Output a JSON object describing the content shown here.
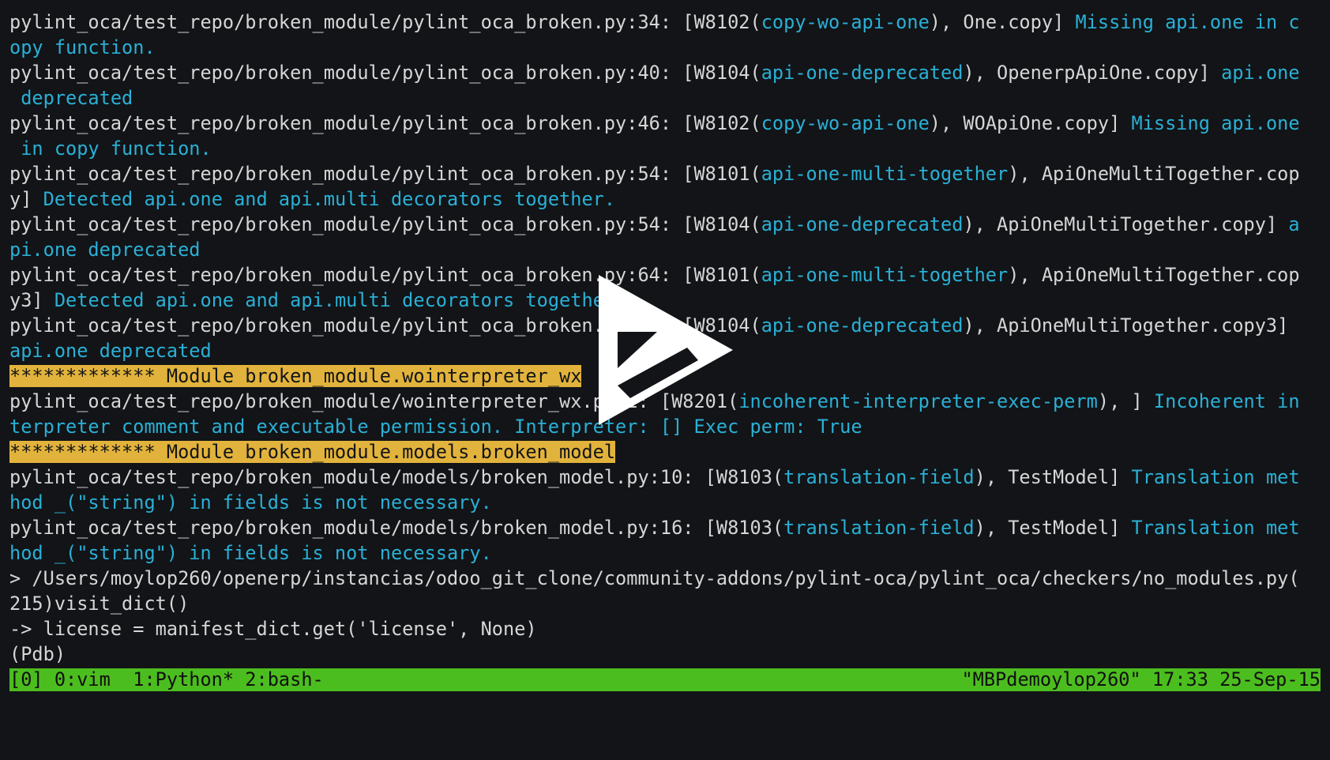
{
  "terminal": {
    "lines": [
      [
        {
          "t": "pylint_oca/test_repo/broken_module/pylint_oca_broken.py:34: [W8102(",
          "c": "white"
        },
        {
          "t": "copy-wo-api-one",
          "c": "cyan"
        },
        {
          "t": "), One.copy] ",
          "c": "white"
        },
        {
          "t": "Missing api.one in c",
          "c": "cyan"
        }
      ],
      [
        {
          "t": "opy function.",
          "c": "cyan"
        }
      ],
      [
        {
          "t": "pylint_oca/test_repo/broken_module/pylint_oca_broken.py:40: [W8104(",
          "c": "white"
        },
        {
          "t": "api-one-deprecated",
          "c": "cyan"
        },
        {
          "t": "), OpenerpApiOne.copy] ",
          "c": "white"
        },
        {
          "t": "api.one",
          "c": "cyan"
        }
      ],
      [
        {
          "t": " deprecated",
          "c": "cyan"
        }
      ],
      [
        {
          "t": "pylint_oca/test_repo/broken_module/pylint_oca_broken.py:46: [W8102(",
          "c": "white"
        },
        {
          "t": "copy-wo-api-one",
          "c": "cyan"
        },
        {
          "t": "), WOApiOne.copy] ",
          "c": "white"
        },
        {
          "t": "Missing api.one",
          "c": "cyan"
        }
      ],
      [
        {
          "t": " in copy function.",
          "c": "cyan"
        }
      ],
      [
        {
          "t": "pylint_oca/test_repo/broken_module/pylint_oca_broken.py:54: [W8101(",
          "c": "white"
        },
        {
          "t": "api-one-multi-together",
          "c": "cyan"
        },
        {
          "t": "), ApiOneMultiTogether.cop",
          "c": "white"
        }
      ],
      [
        {
          "t": "y] ",
          "c": "white"
        },
        {
          "t": "Detected api.one and api.multi decorators together.",
          "c": "cyan"
        }
      ],
      [
        {
          "t": "pylint_oca/test_repo/broken_module/pylint_oca_broken.py:54: [W8104(",
          "c": "white"
        },
        {
          "t": "api-one-deprecated",
          "c": "cyan"
        },
        {
          "t": "), ApiOneMultiTogether.copy] ",
          "c": "white"
        },
        {
          "t": "a",
          "c": "cyan"
        }
      ],
      [
        {
          "t": "pi.one deprecated",
          "c": "cyan"
        }
      ],
      [
        {
          "t": "pylint_oca/test_repo/broken_module/pylint_oca_broken.py:64: [W8101(",
          "c": "white"
        },
        {
          "t": "api-one-multi-together",
          "c": "cyan"
        },
        {
          "t": "), ApiOneMultiTogether.cop",
          "c": "white"
        }
      ],
      [
        {
          "t": "y3] ",
          "c": "white"
        },
        {
          "t": "Detected api.one and api.multi decorators together.",
          "c": "cyan"
        }
      ],
      [
        {
          "t": "pylint_oca/test_repo/broken_module/pylint_oca_broken.py:64: [W8104(",
          "c": "white"
        },
        {
          "t": "api-one-deprecated",
          "c": "cyan"
        },
        {
          "t": "), ApiOneMultiTogether.copy3]",
          "c": "white"
        }
      ],
      [
        {
          "t": "api.one deprecated",
          "c": "cyan"
        }
      ],
      [
        {
          "t": "************* Module broken_module.wointerpreter_wx",
          "c": "hl"
        }
      ],
      [
        {
          "t": "pylint_oca/test_repo/broken_module/wointerpreter_wx.py:1: [W8201(",
          "c": "white"
        },
        {
          "t": "incoherent-interpreter-exec-perm",
          "c": "cyan"
        },
        {
          "t": "), ] ",
          "c": "white"
        },
        {
          "t": "Incoherent in",
          "c": "cyan"
        }
      ],
      [
        {
          "t": "terpreter comment and executable permission. Interpreter: [] Exec perm: True",
          "c": "cyan"
        }
      ],
      [
        {
          "t": "************* Module broken_module.models.broken_model",
          "c": "hl"
        }
      ],
      [
        {
          "t": "pylint_oca/test_repo/broken_module/models/broken_model.py:10: [W8103(",
          "c": "white"
        },
        {
          "t": "translation-field",
          "c": "cyan"
        },
        {
          "t": "), TestModel] ",
          "c": "white"
        },
        {
          "t": "Translation met",
          "c": "cyan"
        }
      ],
      [
        {
          "t": "hod _(\"string\") in fields is not necessary.",
          "c": "cyan"
        }
      ],
      [
        {
          "t": "pylint_oca/test_repo/broken_module/models/broken_model.py:16: [W8103(",
          "c": "white"
        },
        {
          "t": "translation-field",
          "c": "cyan"
        },
        {
          "t": "), TestModel] ",
          "c": "white"
        },
        {
          "t": "Translation met",
          "c": "cyan"
        }
      ],
      [
        {
          "t": "hod _(\"string\") in fields is not necessary.",
          "c": "cyan"
        }
      ],
      [
        {
          "t": "> /Users/moylop260/openerp/instancias/odoo_git_clone/community-addons/pylint-oca/pylint_oca/checkers/no_modules.py(",
          "c": "white"
        }
      ],
      [
        {
          "t": "215)visit_dict()",
          "c": "white"
        }
      ],
      [
        {
          "t": "-> license = manifest_dict.get('license', None)",
          "c": "white"
        }
      ],
      [
        {
          "t": "(Pdb) ",
          "c": "white"
        }
      ]
    ]
  },
  "status_bar": {
    "left": "[0] 0:vim  1:Python* 2:bash-",
    "right": "\"MBPdemoylop260\" 17:33 25-Sep-15",
    "color": "#4cbd1f"
  },
  "overlay": {
    "icon": "play-icon"
  },
  "colors": {
    "background": "#121417",
    "text": "#d6d6d6",
    "cyan": "#2ab0d6",
    "highlight": "#e2b33c"
  }
}
